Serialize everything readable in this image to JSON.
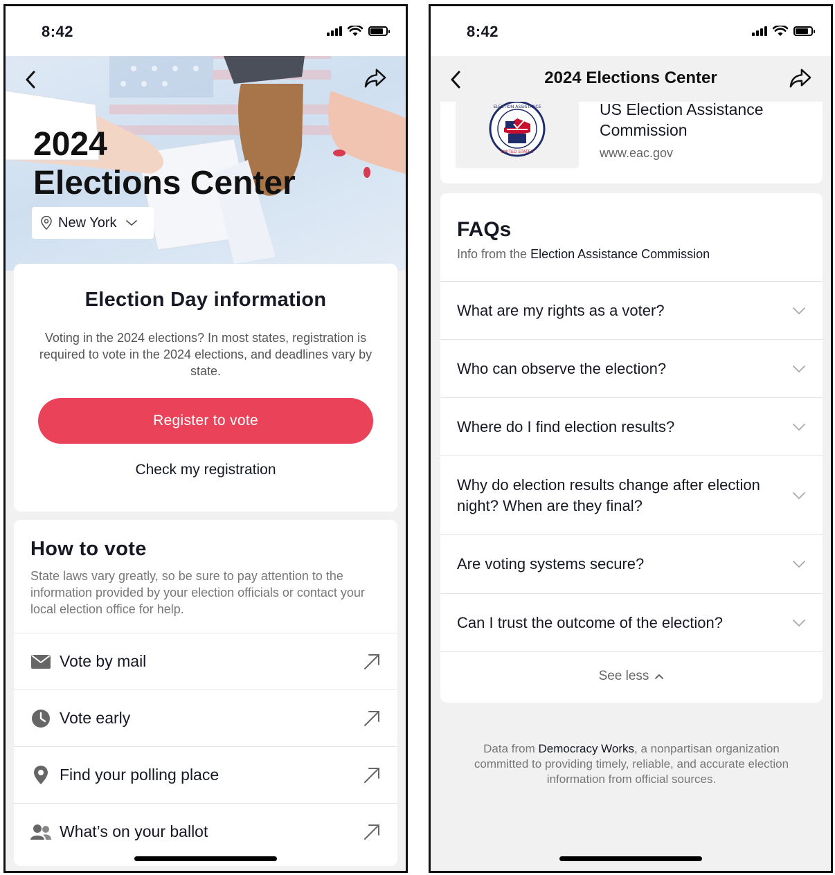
{
  "left": {
    "status_time": "8:42",
    "hero_title_line1": "2024",
    "hero_title_line2": "Elections Center",
    "location": "New York",
    "election_day": {
      "title": "Election Day information",
      "body": "Voting in the 2024 elections? In most states, registration is required to vote in the 2024 elections, and deadlines vary by state.",
      "register_label": "Register to vote",
      "check_label": "Check my registration",
      "accent": "#ea4359"
    },
    "how_to_vote": {
      "title": "How to vote",
      "body": "State laws vary greatly, so be sure to pay attention to the information provided by your election officials or contact your local election office for help.",
      "items": [
        {
          "label": "Vote by mail",
          "icon": "envelope-icon"
        },
        {
          "label": "Vote early",
          "icon": "clock-icon"
        },
        {
          "label": "Find your polling place",
          "icon": "location-pin-icon"
        },
        {
          "label": "What’s on your ballot",
          "icon": "people-icon"
        }
      ]
    }
  },
  "right": {
    "status_time": "8:42",
    "header_title": "2024 Elections Center",
    "eac": {
      "name": "US Election Assistance Commission",
      "url": "www.eac.gov",
      "logo_text": "ELECTION ASSISTANCE COMMISSION · UNITED STATES"
    },
    "faqs": {
      "title": "FAQs",
      "subtitle_prefix": "Info from the",
      "subtitle_source": "Election Assistance Commission",
      "items": [
        "What are my rights as a voter?",
        "Who can observe the election?",
        "Where do I find election results?",
        "Why do election results change after election night? When are they final?",
        "Are voting systems secure?",
        "Can I trust the outcome of the election?"
      ],
      "see_less": "See less"
    },
    "footer": {
      "prefix": "Data from",
      "source": "Democracy Works",
      "suffix": ", a nonpartisan organization committed to providing timely, reliable, and accurate election information from official sources."
    }
  }
}
